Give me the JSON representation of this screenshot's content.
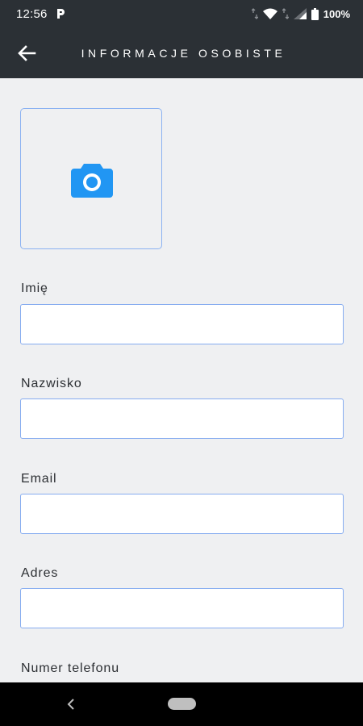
{
  "status_bar": {
    "time": "12:56",
    "battery": "100%",
    "icons": [
      "parking-p-icon",
      "data-arrows-icon",
      "wifi-icon",
      "signal-icon",
      "battery-icon"
    ]
  },
  "app_bar": {
    "title": "INFORMACJE OSOBISTE",
    "back_icon": "arrow-back-icon"
  },
  "photo": {
    "icon": "camera-icon",
    "accent": "#2196f3"
  },
  "fields": [
    {
      "label": "Imię",
      "value": "",
      "placeholder": ""
    },
    {
      "label": "Nazwisko",
      "value": "",
      "placeholder": ""
    },
    {
      "label": "Email",
      "value": "",
      "placeholder": ""
    },
    {
      "label": "Adres",
      "value": "",
      "placeholder": ""
    },
    {
      "label": "Numer telefonu",
      "value": "",
      "placeholder": ""
    }
  ],
  "colors": {
    "header_bg": "#2b3035",
    "page_bg": "#eff0f2",
    "input_border": "#86acf0"
  },
  "nav_bar": {
    "back_icon": "nav-back-icon",
    "home_icon": "nav-home-pill"
  }
}
